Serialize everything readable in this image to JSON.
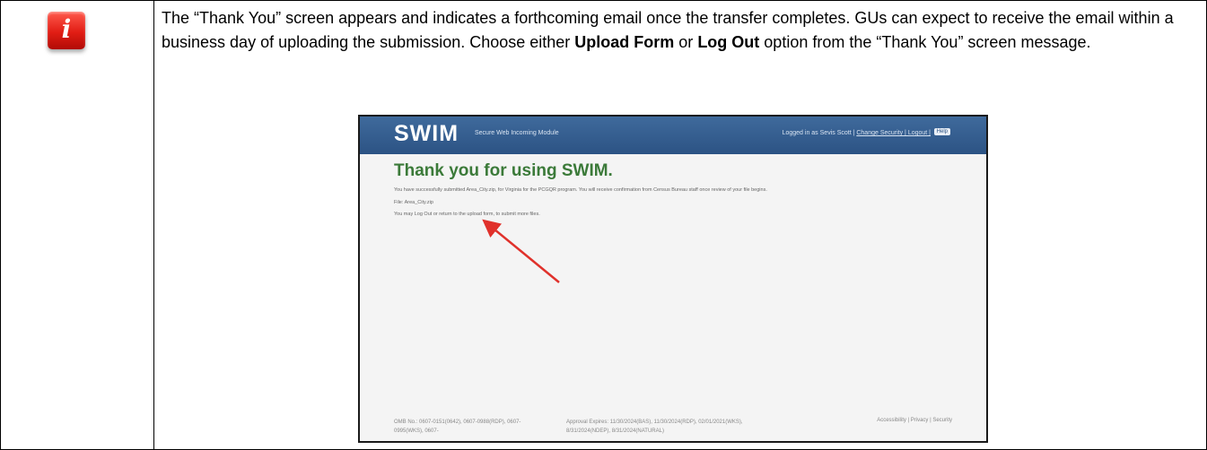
{
  "instruction": {
    "text_1": "The “Thank You” screen appears and indicates a forthcoming email once the transfer completes. GUs can expect to receive the email within a business day of uploading the submission. Choose either ",
    "bold_1": "Upload Form",
    "text_2": " or ",
    "bold_2": "Log Out",
    "text_3": " option from the “Thank You” screen message.",
    "icon": "info-icon",
    "icon_glyph": "i"
  },
  "screenshot": {
    "logo": "SWIM",
    "subtitle": "Secure Web Incoming Module",
    "user_text": "Logged in as Sevis Scott |",
    "user_links": "Change Security | Logout |",
    "help_label": "Help",
    "title": "Thank you for using SWIM.",
    "line_1": "You have successfully submitted Area_City.zip, for Virginia for the PCGQR program. You will receive confirmation from Census Bureau staff once review of your file begins.",
    "line_2": "File: Area_City.zip",
    "line_3": "You may Log Out or return to the upload form, to submit more files.",
    "footer_omb": "OMB No.: 0607-0151(0642), 0607-0988(RDP), 0607-0995(WKS), 0607-",
    "footer_approval": "Approval Expires: 11/30/2024(BAS), 11/30/2024(RDP), 02/01/2021(WKS), 8/31/2024(NDEP), 8/31/2024(NATURAL)",
    "footer_links": "Accessibility | Privacy | Security",
    "arrow_color": "#e0312b",
    "header_color": "#2f5a8c",
    "title_color": "#3b7a39"
  }
}
